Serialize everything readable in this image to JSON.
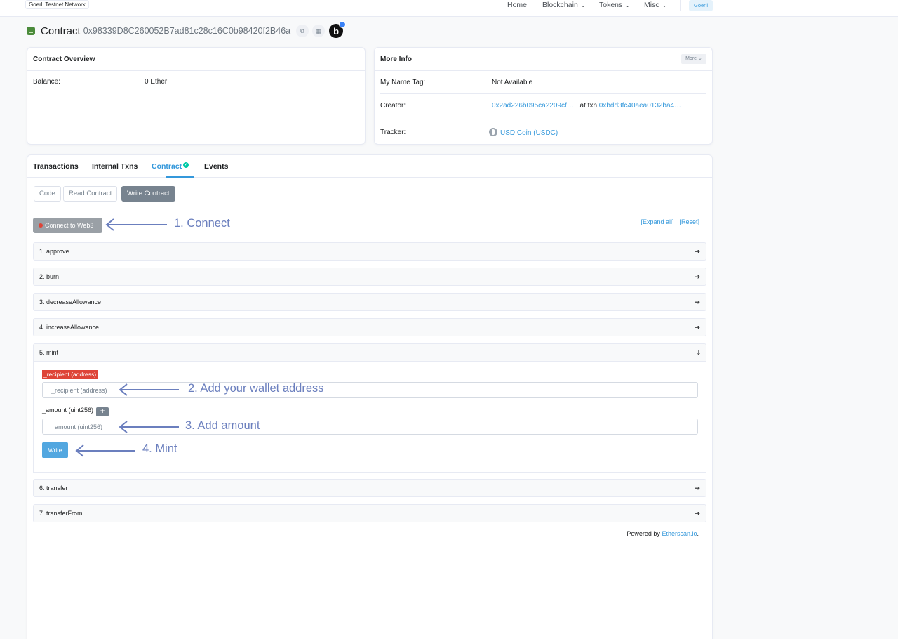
{
  "topnav": {
    "network_label": "Goerli Testnet Network",
    "items": [
      {
        "label": "Home",
        "has_dropdown": false
      },
      {
        "label": "Blockchain",
        "has_dropdown": true
      },
      {
        "label": "Tokens",
        "has_dropdown": true
      },
      {
        "label": "Misc",
        "has_dropdown": true
      }
    ],
    "network_button": "Goerli",
    "dropdown_glyph": "⌄"
  },
  "heading": {
    "title": "Contract",
    "address": "0x98339D8C260052B7ad81c28c16C0b98420f2B46a",
    "copy_icon": "⧉",
    "qr_icon": "▦",
    "logo_letter": "b"
  },
  "overview": {
    "title": "Contract Overview",
    "balance_label": "Balance:",
    "balance_value": "0 Ether"
  },
  "more_info": {
    "title": "More Info",
    "more_button": "More ⌄",
    "name_tag_label": "My Name Tag:",
    "name_tag_value": "Not Available",
    "creator_label": "Creator:",
    "creator_address": "0x2ad226b095ca2209cf…",
    "creator_at_txn": "at txn",
    "creator_txn": "0xbdd3fc40aea0132ba4…",
    "tracker_label": "Tracker:",
    "tracker_value": "USD Coin (USDC)"
  },
  "tabs": {
    "transactions": "Transactions",
    "internal": "Internal Txns",
    "contract": "Contract",
    "contract_check": "✓",
    "events": "Events"
  },
  "subtabs": {
    "code": "Code",
    "read": "Read Contract",
    "write": "Write Contract"
  },
  "connect_button": "Connect to Web3",
  "expand_all": "[Expand all]",
  "reset": "[Reset]",
  "functions": [
    {
      "label": "1. approve",
      "arrow": "➔"
    },
    {
      "label": "2. burn",
      "arrow": "➔"
    },
    {
      "label": "3. decreaseAllowance",
      "arrow": "➔"
    },
    {
      "label": "4. increaseAllowance",
      "arrow": "➔"
    },
    {
      "label": "5. mint",
      "arrow": "🡓"
    },
    {
      "label": "6. transfer",
      "arrow": "➔"
    },
    {
      "label": "7. transferFrom",
      "arrow": "➔"
    }
  ],
  "mint": {
    "recipient_label": "_recipient (address)",
    "recipient_placeholder": "_recipient (address)",
    "amount_label": "_amount (uint256)",
    "amount_plus": "+",
    "amount_placeholder": "_amount (uint256)",
    "write_button": "Write"
  },
  "footer": {
    "powered_by": "Powered by",
    "etherscan": "Etherscan.io",
    "period": "."
  },
  "annotations": {
    "step1": "1. Connect",
    "step2": "2. Add your wallet address",
    "step3": "3. Add amount",
    "step4": "4. Mint",
    "color": "#6b7fbe"
  },
  "colors": {
    "link": "#3498db",
    "danger": "#de4437",
    "success": "#00c9a7",
    "secondary": "#77838f"
  }
}
